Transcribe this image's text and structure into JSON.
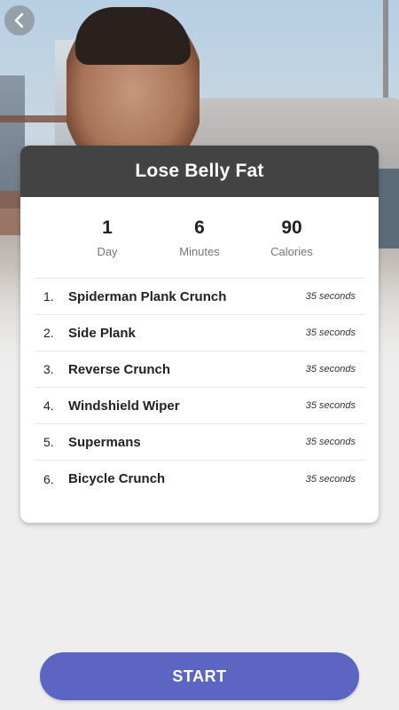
{
  "header": {
    "back_icon": "chevron-left-icon"
  },
  "workout": {
    "title": "Lose Belly Fat",
    "stats": [
      {
        "value": "1",
        "label": "Day"
      },
      {
        "value": "6",
        "label": "Minutes"
      },
      {
        "value": "90",
        "label": "Calories"
      }
    ],
    "exercises": [
      {
        "number": "1.",
        "name": "Spiderman Plank Crunch",
        "duration": "35 seconds"
      },
      {
        "number": "2.",
        "name": "Side Plank",
        "duration": "35 seconds"
      },
      {
        "number": "3.",
        "name": "Reverse Crunch",
        "duration": "35 seconds"
      },
      {
        "number": "4.",
        "name": "Windshield Wiper",
        "duration": "35 seconds"
      },
      {
        "number": "5.",
        "name": "Supermans",
        "duration": "35 seconds"
      },
      {
        "number": "6.",
        "name": "Bicycle Crunch",
        "duration": "35 seconds"
      }
    ]
  },
  "actions": {
    "start_label": "START"
  },
  "colors": {
    "header_bg": "#434343",
    "accent": "#5c66c2",
    "page_bg": "#eeeeee"
  }
}
